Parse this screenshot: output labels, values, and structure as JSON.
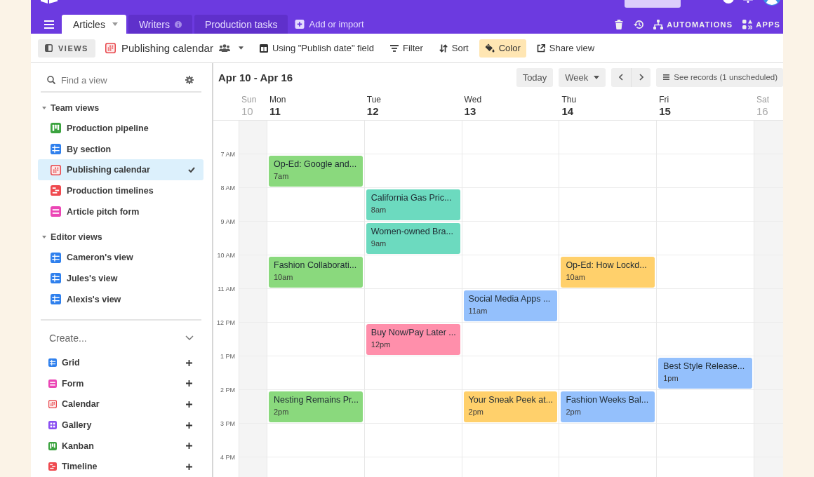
{
  "tabs": [
    {
      "label": "Articles",
      "selected": true,
      "dropdown": true,
      "info": false
    },
    {
      "label": "Writers",
      "selected": false,
      "dropdown": false,
      "info": true
    },
    {
      "label": "Production tasks",
      "selected": false,
      "dropdown": false,
      "info": false
    }
  ],
  "add_tab": "Add or import",
  "utilities": [
    {
      "kind": "trash"
    },
    {
      "kind": "history"
    },
    {
      "kind": "automations",
      "label": "AUTOMATIONS"
    },
    {
      "kind": "apps",
      "label": "APPS"
    }
  ],
  "toolbar": {
    "views": "VIEWS",
    "view": {
      "name": "Publishing calendar",
      "kind": "calendar",
      "shared": true
    },
    "actions": [
      {
        "kind": "date_field",
        "label": "Using \"Publish date\" field",
        "active": false
      },
      {
        "kind": "filter",
        "label": "Filter",
        "active": false
      },
      {
        "kind": "sort",
        "label": "Sort",
        "active": false
      },
      {
        "kind": "color",
        "label": "Color",
        "active": true
      },
      {
        "kind": "share",
        "label": "Share view",
        "active": false
      }
    ]
  },
  "sidebar": {
    "search": {
      "placeholder": "Find a view"
    },
    "sections": [
      {
        "title": "Team views",
        "expanded": true,
        "items": [
          {
            "label": "Production pipeline",
            "kind": "kanban",
            "selected": false
          },
          {
            "label": "By section",
            "kind": "grid",
            "selected": false
          },
          {
            "label": "Publishing calendar",
            "kind": "calendar",
            "selected": true
          },
          {
            "label": "Production timelines",
            "kind": "timeline",
            "selected": false
          },
          {
            "label": "Article pitch form",
            "kind": "form",
            "selected": false
          }
        ]
      },
      {
        "title": "Editor views",
        "expanded": true,
        "items": [
          {
            "label": "Cameron's view",
            "kind": "grid",
            "selected": false
          },
          {
            "label": "Jules's view",
            "kind": "grid",
            "selected": false
          },
          {
            "label": "Alexis's view",
            "kind": "grid",
            "selected": false
          }
        ]
      }
    ],
    "create": {
      "title": "Create...",
      "expanded": true,
      "items": [
        {
          "label": "Grid",
          "kind": "grid"
        },
        {
          "label": "Form",
          "kind": "form"
        },
        {
          "label": "Calendar",
          "kind": "calendar"
        },
        {
          "label": "Gallery",
          "kind": "gallery"
        },
        {
          "label": "Kanban",
          "kind": "kanban"
        },
        {
          "label": "Timeline",
          "kind": "timeline"
        }
      ]
    }
  },
  "calendar": {
    "range": "Apr 10 - Apr 16",
    "today": "Today",
    "period": "Week",
    "records": "See records (1 unscheduled)",
    "days": [
      {
        "name": "Sun",
        "date": "10",
        "weekend": true
      },
      {
        "name": "Mon",
        "date": "11",
        "weekend": false
      },
      {
        "name": "Tue",
        "date": "12",
        "weekend": false
      },
      {
        "name": "Wed",
        "date": "13",
        "weekend": false
      },
      {
        "name": "Thu",
        "date": "14",
        "weekend": false
      },
      {
        "name": "Fri",
        "date": "15",
        "weekend": false
      },
      {
        "name": "Sat",
        "date": "16",
        "weekend": true
      }
    ],
    "rows": [
      {
        "label": "7 AM",
        "cells": [
          null,
          {
            "title": "Op-Ed: Google and...",
            "time": "7am",
            "color": "#8ad97d"
          },
          null,
          null,
          null,
          null,
          null
        ]
      },
      {
        "label": "8 AM",
        "cells": [
          null,
          null,
          {
            "title": "California Gas Pric...",
            "time": "8am",
            "color": "#6cdabf"
          },
          null,
          null,
          null,
          null
        ]
      },
      {
        "label": "9 AM",
        "cells": [
          null,
          null,
          {
            "title": "Women-owned Bra...",
            "time": "9am",
            "color": "#6cdabf"
          },
          null,
          null,
          null,
          null
        ]
      },
      {
        "label": "10 AM",
        "cells": [
          null,
          {
            "title": "Fashion Collaborati...",
            "time": "10am",
            "color": "#8ad97d"
          },
          null,
          null,
          {
            "title": "Op-Ed: How Lockd...",
            "time": "10am",
            "color": "#ffd06b"
          },
          null,
          null
        ]
      },
      {
        "label": "11 AM",
        "cells": [
          null,
          null,
          null,
          {
            "title": "Social Media Apps ...",
            "time": "11am",
            "color": "#94c0fc"
          },
          null,
          null,
          null
        ]
      },
      {
        "label": "12 PM",
        "cells": [
          null,
          null,
          {
            "title": "Buy Now/Pay Later ...",
            "time": "12pm",
            "color": "#ff8fab"
          },
          null,
          null,
          null,
          null
        ]
      },
      {
        "label": "1 PM",
        "cells": [
          null,
          null,
          null,
          null,
          null,
          {
            "title": "Best Style Release...",
            "time": "1pm",
            "color": "#94c0fc"
          },
          null
        ]
      },
      {
        "label": "2 PM",
        "cells": [
          null,
          {
            "title": "Nesting Remains Pr...",
            "time": "2pm",
            "color": "#8ad97d"
          },
          null,
          {
            "title": "Your Sneak Peek at...",
            "time": "2pm",
            "color": "#ffd06b"
          },
          {
            "title": "Fashion Weeks Bal...",
            "time": "2pm",
            "color": "#94c0fc"
          },
          null,
          null
        ]
      },
      {
        "label": "3 PM",
        "cells": [
          null,
          null,
          null,
          null,
          null,
          null,
          null
        ]
      },
      {
        "label": "4 PM",
        "cells": [
          null,
          null,
          null,
          null,
          null,
          null,
          null
        ]
      }
    ]
  }
}
